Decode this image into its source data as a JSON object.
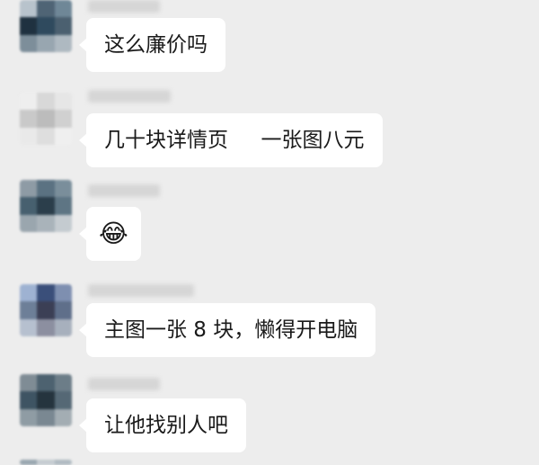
{
  "messages": [
    {
      "text": "这么廉价吗",
      "avatar_colors": [
        "#b8c3cc",
        "#4f6475",
        "#6f8797",
        "#1f3140",
        "#2f4a5e",
        "#4b6070",
        "#7d8e9a",
        "#98a6b0",
        "#aeb9c1"
      ]
    },
    {
      "text": "几十块详情页     一张图八元",
      "avatar_colors": [
        "#eeeeee",
        "#d8d8d8",
        "#e6e6e6",
        "#c9c9c9",
        "#bcbcbc",
        "#d0d0d0",
        "#e9e9e9",
        "#dedede",
        "#efefef"
      ]
    },
    {
      "text": "😂",
      "avatar_colors": [
        "#8e9ba5",
        "#5b7282",
        "#7a8e9b",
        "#47606f",
        "#2b3e4b",
        "#5e7584",
        "#9aa6ae",
        "#a9b3ba",
        "#c4cbd0"
      ]
    },
    {
      "text": "主图一张 8 块，懒得开电脑",
      "avatar_colors": [
        "#9eb2d2",
        "#3a4f7a",
        "#7e8fb0",
        "#6d7f98",
        "#3b3f55",
        "#5f6f8a",
        "#b6c0cf",
        "#8c8fa0",
        "#a7b0bd"
      ]
    },
    {
      "text": "让他找别人吧",
      "avatar_colors": [
        "#7f8c95",
        "#4d6270",
        "#6c7d88",
        "#3e5463",
        "#25343e",
        "#556875",
        "#8f9ca4",
        "#7a8892",
        "#a3adb3"
      ]
    }
  ],
  "partial_bottom_avatar_colors": [
    "#9aa7b0",
    "#c5ccd1",
    "#b0bbc2"
  ]
}
